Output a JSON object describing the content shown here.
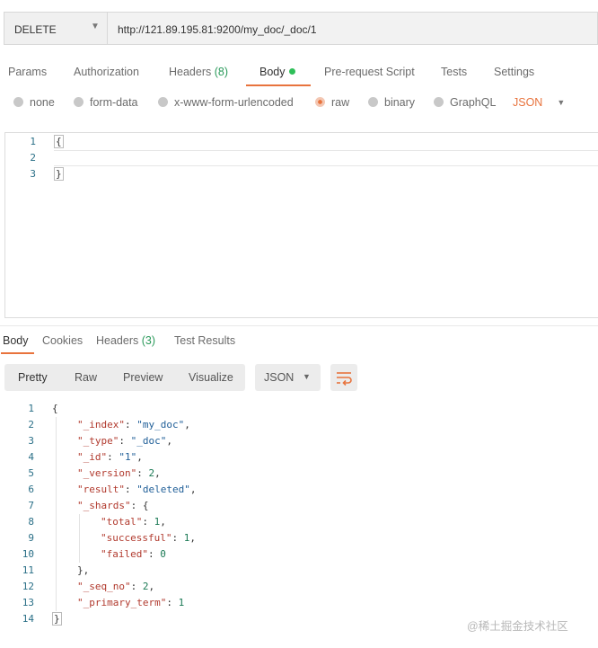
{
  "request": {
    "method": "DELETE",
    "url": "http://121.89.195.81:9200/my_doc/_doc/1"
  },
  "request_tabs": [
    {
      "label": "Params"
    },
    {
      "label": "Authorization"
    },
    {
      "label": "Headers",
      "count": "(8)"
    },
    {
      "label": "Body"
    },
    {
      "label": "Pre-request Script"
    },
    {
      "label": "Tests"
    },
    {
      "label": "Settings"
    }
  ],
  "body_types": [
    "none",
    "form-data",
    "x-www-form-urlencoded",
    "raw",
    "binary",
    "GraphQL"
  ],
  "body_format": "JSON",
  "request_body": {
    "line_numbers": [
      "1",
      "2",
      "3"
    ],
    "lines": [
      "{",
      "",
      "}"
    ]
  },
  "response_tabs": [
    {
      "label": "Body"
    },
    {
      "label": "Cookies"
    },
    {
      "label": "Headers",
      "count": "(3)"
    },
    {
      "label": "Test Results"
    }
  ],
  "view_modes": [
    "Pretty",
    "Raw",
    "Preview",
    "Visualize"
  ],
  "response_format": "JSON",
  "response_body": {
    "line_numbers": [
      "1",
      "2",
      "3",
      "4",
      "5",
      "6",
      "7",
      "8",
      "9",
      "10",
      "11",
      "12",
      "13",
      "14"
    ],
    "lines": [
      "{",
      "\"_index\": \"my_doc\",",
      "\"_type\": \"_doc\",",
      "\"_id\": \"1\",",
      "\"_version\": 2,",
      "\"result\": \"deleted\",",
      "\"_shards\": {",
      "\"total\": 1,",
      "\"successful\": 1,",
      "\"failed\": 0",
      "},",
      "\"_seq_no\": 2,",
      "\"_primary_term\": 1",
      "}"
    ]
  },
  "watermark": "@稀土掘金技术社区",
  "colors": {
    "accent": "#e8733d",
    "count_green": "#2b9a5b",
    "dot_green": "#2fbf59"
  }
}
